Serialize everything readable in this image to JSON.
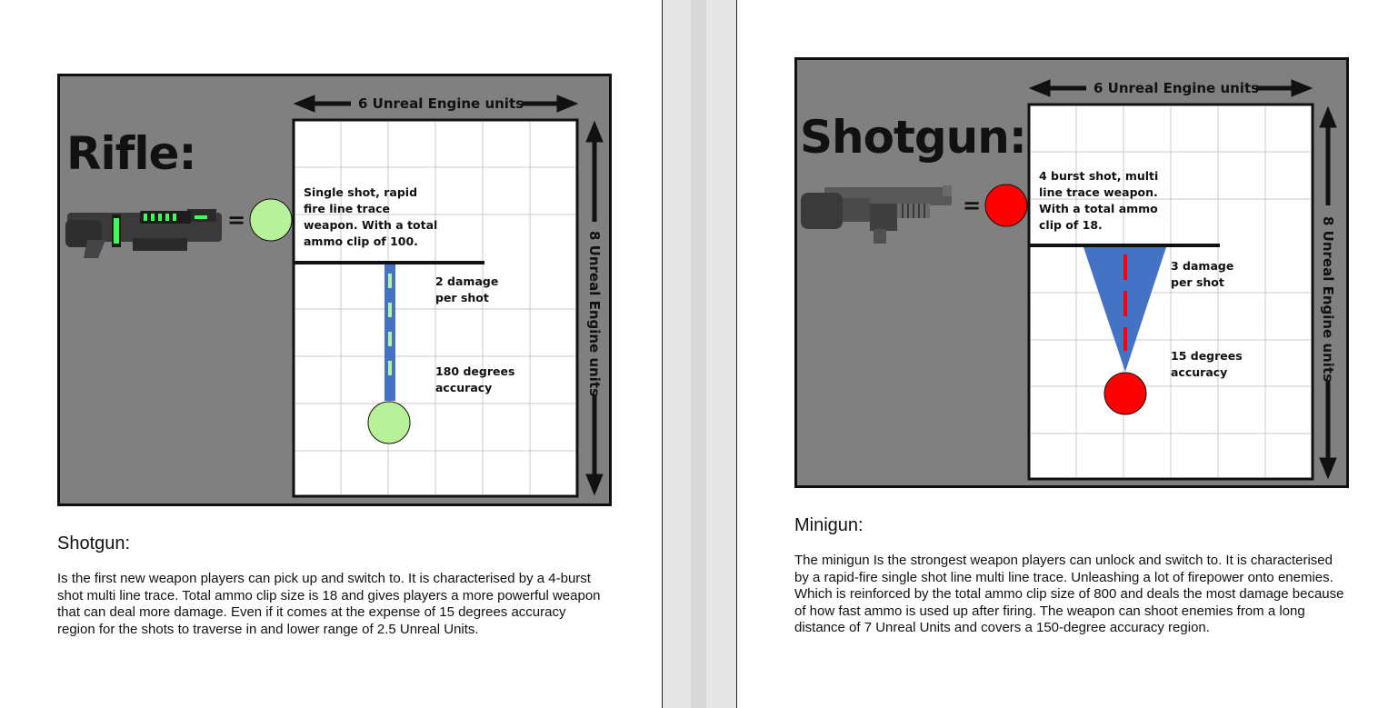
{
  "left_page": {
    "figure": {
      "title": "Rifle:",
      "width_label": "6 Unreal Engine units",
      "height_label": "8 Unreal Engine units",
      "description": "Single shot, rapid fire line trace weapon. With a total ammo clip of 100.",
      "damage": "2 damage per shot",
      "accuracy": "180 degrees accuracy",
      "equals": "="
    },
    "heading": "Shotgun:",
    "paragraph": "Is the first new weapon players can pick up and switch to. It is characterised by a 4-burst shot multi line trace. Total ammo clip size is 18 and gives players a more powerful weapon that can deal more damage. Even if it comes at the expense of 15 degrees accuracy region for the shots to traverse in and lower range of 2.5 Unreal Units."
  },
  "right_page": {
    "figure": {
      "title": "Shotgun:",
      "width_label": "6 Unreal Engine units",
      "height_label": "8 Unreal Engine units",
      "description": "4 burst shot, multi line trace weapon. With a total ammo clip of 18.",
      "damage": "3 damage per shot",
      "accuracy": "15 degrees accuracy",
      "equals": "="
    },
    "heading": "Minigun:",
    "paragraph": "The minigun Is the strongest weapon players can unlock and switch to. It is characterised by a rapid-fire single shot line multi line trace. Unleashing a lot of firepower onto enemies. Which is reinforced by the total ammo clip size of 800 and deals the most damage because of how fast ammo is used up after firing. The weapon can shoot enemies from a long distance of 7 Unreal Units and covers a 150-degree accuracy region."
  },
  "colors": {
    "figure_bg": "#808080",
    "rifle_marker": "#b7f29a",
    "shotgun_marker": "#ff0000",
    "trace_blue": "#4472c4",
    "glow_green": "#39ff5a"
  }
}
